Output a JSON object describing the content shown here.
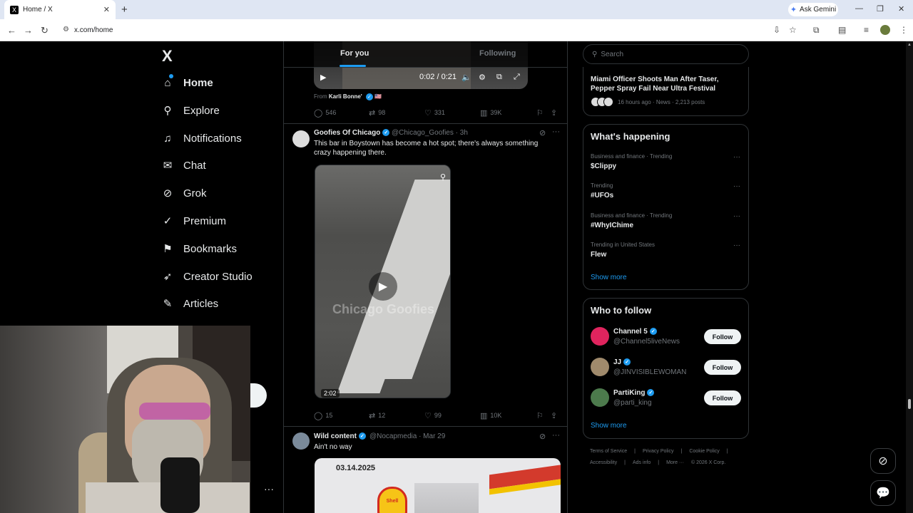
{
  "browser": {
    "tab_title": "Home / X",
    "tab_favicon": "X",
    "new_tab_icon": "+",
    "gemini_label": "Ask Gemini",
    "url": "x.com/home"
  },
  "nav": {
    "logo": "X",
    "items": [
      {
        "label": "Home",
        "icon": "home-icon"
      },
      {
        "label": "Explore",
        "icon": "search-icon"
      },
      {
        "label": "Notifications",
        "icon": "bell-icon"
      },
      {
        "label": "Chat",
        "icon": "mail-icon"
      },
      {
        "label": "Grok",
        "icon": "grok-icon"
      },
      {
        "label": "Premium",
        "icon": "premium-icon"
      },
      {
        "label": "Bookmarks",
        "icon": "bookmark-icon"
      },
      {
        "label": "Creator Studio",
        "icon": "rocket-icon"
      },
      {
        "label": "Articles",
        "icon": "articles-icon"
      }
    ],
    "more": "···"
  },
  "feed": {
    "tabs": [
      "For you",
      "Following"
    ],
    "video1": {
      "time": "0:02 / 0:21"
    },
    "from_prefix": "From",
    "from_name": "Karli Bonne'",
    "from_flag": "🇺🇸",
    "post1_actions": {
      "replies": "546",
      "reposts": "98",
      "likes": "331",
      "views": "39K"
    },
    "post2": {
      "name": "Goofies Of Chicago",
      "handle_time": "@Chicago_Goofies · 3h",
      "text": "This bar in Boystown has become a hot spot; there's always something crazy happening there.",
      "watermark": "Chicago Goofies",
      "duration": "2:02",
      "actions": {
        "replies": "15",
        "reposts": "12",
        "likes": "99",
        "views": "10K"
      }
    },
    "post3": {
      "name": "Wild content",
      "handle_time": "@Nocapmedia · Mar 29",
      "text": "Ain't no way",
      "media_date": "03.14.2025",
      "sign": "Shell"
    }
  },
  "right": {
    "search_placeholder": "Search",
    "news": {
      "title": "Miami Officer Shoots Man After Taser, Pepper Spray Fail Near Ultra Festival",
      "meta": "16 hours ago · News · 2,213 posts"
    },
    "whats_happening": {
      "title": "What's happening",
      "trends": [
        {
          "category": "Business and finance · Trending",
          "name": "$Clippy"
        },
        {
          "category": "Trending",
          "name": "#UFOs"
        },
        {
          "category": "Business and finance · Trending",
          "name": "#WhyIChime"
        },
        {
          "category": "Trending in United States",
          "name": "Flew"
        }
      ],
      "show_more": "Show more"
    },
    "who_to_follow": {
      "title": "Who to follow",
      "accounts": [
        {
          "name": "Channel 5",
          "handle": "@Channel5liveNews",
          "button": "Follow"
        },
        {
          "name": "JJ",
          "handle": "@JINVISIBLEWOMAN",
          "button": "Follow"
        },
        {
          "name": "PartiKing",
          "handle": "@parti_king",
          "button": "Follow"
        }
      ],
      "show_more": "Show more"
    },
    "footer": {
      "line1": [
        "Terms of Service",
        "|",
        "Privacy Policy",
        "|",
        "Cookie Policy",
        "|"
      ],
      "line2": [
        "Accessibility",
        "|",
        "Ads info",
        "|",
        "More ···",
        "© 2026 X Corp."
      ]
    }
  },
  "colors": {
    "accent": "#1d9bf0",
    "background": "#000000",
    "border": "#2f3336",
    "muted": "#71767b"
  }
}
